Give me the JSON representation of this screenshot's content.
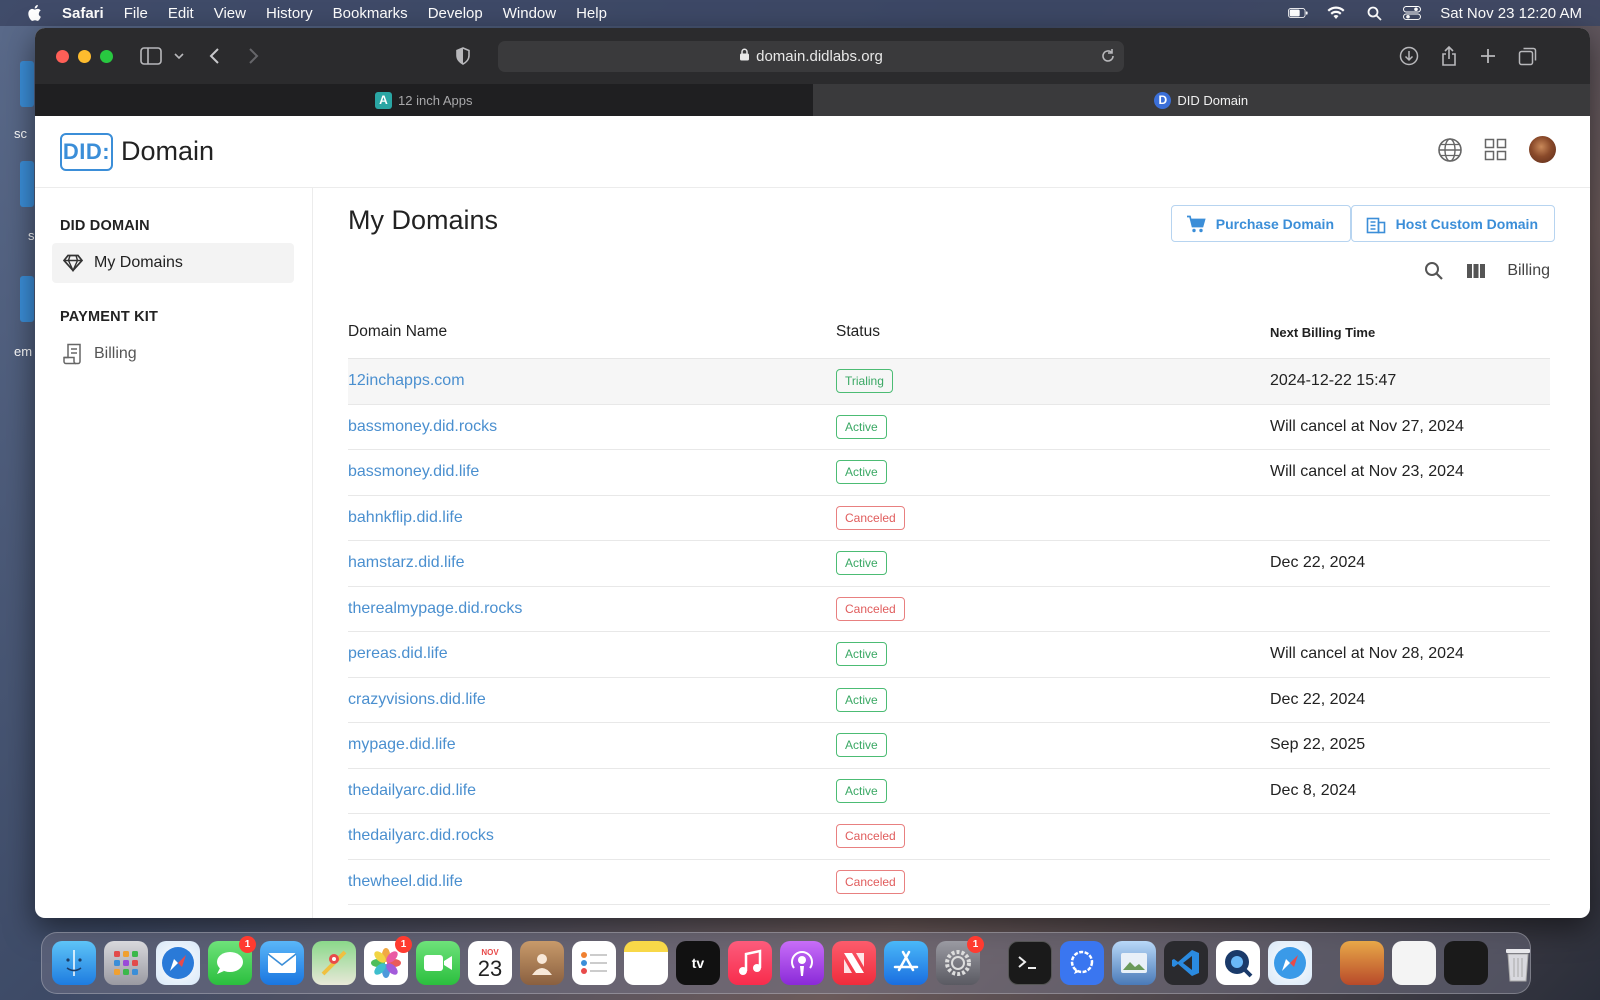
{
  "menubar": {
    "app_name": "Safari",
    "items": [
      "File",
      "Edit",
      "View",
      "History",
      "Bookmarks",
      "Develop",
      "Window",
      "Help"
    ],
    "datetime": "Sat Nov 23  12:20 AM"
  },
  "desktop": {
    "labels": [
      "sc",
      "s",
      "em"
    ]
  },
  "browser": {
    "url": "domain.didlabs.org",
    "tabs": [
      {
        "label": "12 inch Apps",
        "favicon": "A",
        "active": false
      },
      {
        "label": "DID Domain",
        "favicon": "D",
        "active": true
      }
    ]
  },
  "app": {
    "logo_mark": "DID:",
    "logo_text": "Domain",
    "sidebar": {
      "section1": "DID DOMAIN",
      "item_my_domains": "My Domains",
      "section2": "PAYMENT KIT",
      "item_billing": "Billing"
    },
    "page_title": "My Domains",
    "purchase_button": "Purchase Domain",
    "host_button": "Host Custom Domain",
    "billing_label": "Billing",
    "table": {
      "headers": [
        "Domain Name",
        "Status",
        "Next Billing Time"
      ],
      "rows": [
        {
          "domain": "12inchapps.com",
          "status": "Trialing",
          "billing": "2024-12-22 15:47"
        },
        {
          "domain": "bassmoney.did.rocks",
          "status": "Active",
          "billing": "Will cancel at Nov 27, 2024"
        },
        {
          "domain": "bassmoney.did.life",
          "status": "Active",
          "billing": "Will cancel at Nov 23, 2024"
        },
        {
          "domain": "bahnkflip.did.life",
          "status": "Canceled",
          "billing": ""
        },
        {
          "domain": "hamstarz.did.life",
          "status": "Active",
          "billing": "Dec 22, 2024"
        },
        {
          "domain": "therealmypage.did.rocks",
          "status": "Canceled",
          "billing": ""
        },
        {
          "domain": "pereas.did.life",
          "status": "Active",
          "billing": "Will cancel at Nov 28, 2024"
        },
        {
          "domain": "crazyvisions.did.life",
          "status": "Active",
          "billing": "Dec 22, 2024"
        },
        {
          "domain": "mypage.did.life",
          "status": "Active",
          "billing": "Sep 22, 2025"
        },
        {
          "domain": "thedailyarc.did.life",
          "status": "Active",
          "billing": "Dec 8, 2024"
        },
        {
          "domain": "thedailyarc.did.rocks",
          "status": "Canceled",
          "billing": ""
        },
        {
          "domain": "thewheel.did.life",
          "status": "Canceled",
          "billing": ""
        }
      ]
    }
  },
  "dock": {
    "calendar_month": "NOV",
    "calendar_day": "23",
    "tv_label": "tv",
    "badges": {
      "messages": "1",
      "photos": "1",
      "settings": "1"
    }
  },
  "colors": {
    "accent": "#3b8ed8",
    "active_status": "#3aa864",
    "canceled_status": "#e05c5c"
  }
}
